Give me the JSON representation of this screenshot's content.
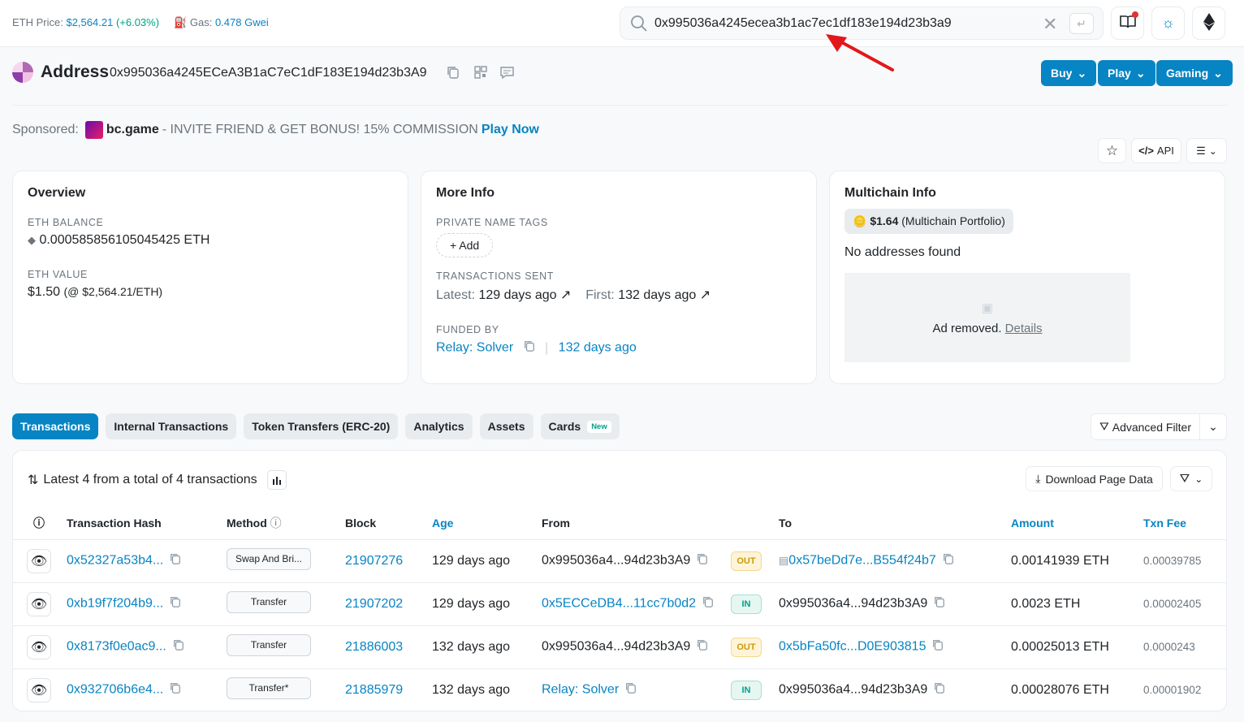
{
  "topbar": {
    "eth_price_label": "ETH Price:",
    "eth_price_value": "$2,564.21",
    "eth_price_change": "(+6.03%)",
    "gas_label": "Gas:",
    "gas_value": "0.478 Gwei",
    "search_value": "0x995036a4245ecea3b1ac7ec1df183e194d23b3a9",
    "icons": [
      "search-icon",
      "clear-icon",
      "enter-icon",
      "book-icon",
      "sun-icon",
      "ethereum-icon"
    ]
  },
  "address": {
    "title": "Address",
    "hash": "0x995036a4245ECeA3B1aC7eC1dF183E194d23b3A9",
    "buttons": [
      "Buy",
      "Play",
      "Gaming"
    ]
  },
  "sponsor": {
    "label": "Sponsored:",
    "brand": "bc.game",
    "text": "- INVITE FRIEND & GET BONUS! 15% COMMISSION",
    "cta": "Play Now"
  },
  "tools": {
    "api": "API"
  },
  "overview": {
    "title": "Overview",
    "balance_label": "ETH BALANCE",
    "balance_value": "0.000585856105045425 ETH",
    "value_label": "ETH VALUE",
    "value_main": "$1.50",
    "value_sub": "(@ $2,564.21/ETH)"
  },
  "more_info": {
    "title": "More Info",
    "tags_label": "PRIVATE NAME TAGS",
    "add_label": "+ Add",
    "sent_label": "TRANSACTIONS SENT",
    "latest_label": "Latest:",
    "latest_value": "129 days ago",
    "first_label": "First:",
    "first_value": "132 days ago",
    "funded_label": "FUNDED BY",
    "funded_by": "Relay: Solver",
    "funded_age": "132 days ago"
  },
  "multichain": {
    "title": "Multichain Info",
    "portfolio_value": "$1.64",
    "portfolio_label": "(Multichain Portfolio)",
    "no_addresses": "No addresses found",
    "ad_text": "Ad removed.",
    "ad_link": "Details"
  },
  "tabs": [
    {
      "label": "Transactions"
    },
    {
      "label": "Internal Transactions"
    },
    {
      "label": "Token Transfers (ERC-20)"
    },
    {
      "label": "Analytics"
    },
    {
      "label": "Assets"
    },
    {
      "label": "Cards",
      "badge": "New"
    }
  ],
  "advanced_filter": "Advanced Filter",
  "tx_summary": "Latest 4 from a total of 4 transactions",
  "download_label": "Download Page Data",
  "columns": [
    "Transaction Hash",
    "Method",
    "Block",
    "Age",
    "From",
    "To",
    "Amount",
    "Txn Fee"
  ],
  "rows": [
    {
      "hash": "0x52327a53b4...",
      "method": "Swap And Bri...",
      "block": "21907276",
      "age": "129 days ago",
      "from": "0x995036a4...94d23b3A9",
      "from_link": false,
      "dir": "OUT",
      "to": "0x57beDd7e...B554f24b7",
      "to_contract": true,
      "amount": "0.00141939 ETH",
      "fee": "0.00039785"
    },
    {
      "hash": "0xb19f7f204b9...",
      "method": "Transfer",
      "block": "21907202",
      "age": "129 days ago",
      "from": "0x5ECCeDB4...11cc7b0d2",
      "from_link": true,
      "dir": "IN",
      "to": "0x995036a4...94d23b3A9",
      "to_contract": false,
      "amount": "0.0023 ETH",
      "fee": "0.00002405"
    },
    {
      "hash": "0x8173f0e0ac9...",
      "method": "Transfer",
      "block": "21886003",
      "age": "132 days ago",
      "from": "0x995036a4...94d23b3A9",
      "from_link": false,
      "dir": "OUT",
      "to": "0x5bFa50fc...D0E903815",
      "to_contract": false,
      "amount": "0.00025013 ETH",
      "fee": "0.0000243"
    },
    {
      "hash": "0x932706b6e4...",
      "method": "Transfer*",
      "block": "21885979",
      "age": "132 days ago",
      "from": "Relay: Solver",
      "from_link": true,
      "dir": "IN",
      "to": "0x995036a4...94d23b3A9",
      "to_contract": false,
      "amount": "0.00028076 ETH",
      "fee": "0.00001902"
    }
  ]
}
